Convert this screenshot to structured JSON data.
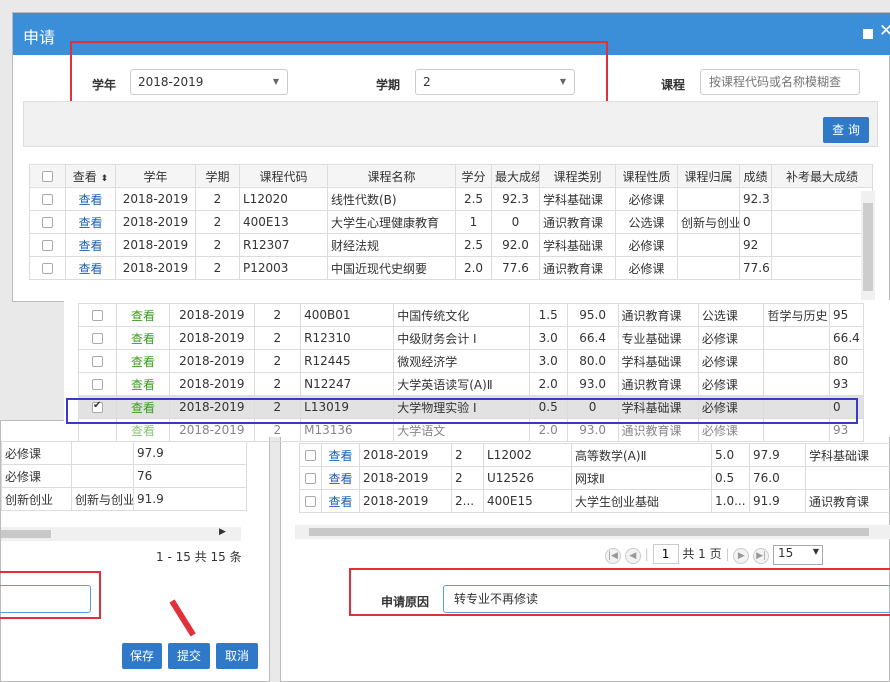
{
  "dialog": {
    "title": "申请",
    "filters": {
      "year_label": "学年",
      "year_value": "2018-2019",
      "term_label": "学期",
      "term_value": "2",
      "course_label": "课程",
      "course_placeholder": "按课程代码或名称模糊查"
    },
    "search_button": "查 询"
  },
  "grid_top": {
    "headers": [
      "查看",
      "学年",
      "学期",
      "课程代码",
      "课程名称",
      "学分",
      "最大成绩",
      "课程类别",
      "课程性质",
      "课程归属",
      "成绩",
      "补考最大成绩"
    ],
    "rows": [
      [
        "查看",
        "2018-2019",
        "2",
        "L12020",
        "线性代数(B)",
        "2.5",
        "92.3",
        "学科基础课",
        "必修课",
        "",
        "92.3"
      ],
      [
        "查看",
        "2018-2019",
        "2",
        "400E13",
        "大学生心理健康教育",
        "1",
        "0",
        "通识教育课",
        "公选课",
        "创新与创业",
        "0"
      ],
      [
        "查看",
        "2018-2019",
        "2",
        "R12307",
        "财经法规",
        "2.5",
        "92.0",
        "学科基础课",
        "必修课",
        "",
        "92"
      ],
      [
        "查看",
        "2018-2019",
        "2",
        "P12003",
        "中国近现代史纲要",
        "2.0",
        "77.6",
        "通识教育课",
        "必修课",
        "",
        "77.6"
      ]
    ]
  },
  "grid_overlay": {
    "rows": [
      [
        "查看",
        "2018-2019",
        "2",
        "400B01",
        "中国传统文化",
        "1.5",
        "95.0",
        "通识教育课",
        "公选课",
        "哲学与历史",
        "95"
      ],
      [
        "查看",
        "2018-2019",
        "2",
        "R12310",
        "中级财务会计 I",
        "3.0",
        "66.4",
        "专业基础课",
        "必修课",
        "",
        "66.4"
      ],
      [
        "查看",
        "2018-2019",
        "2",
        "R12445",
        "微观经济学",
        "3.0",
        "80.0",
        "学科基础课",
        "必修课",
        "",
        "80"
      ],
      [
        "查看",
        "2018-2019",
        "2",
        "N12247",
        "大学英语读写(A)Ⅱ",
        "2.0",
        "93.0",
        "通识教育课",
        "必修课",
        "",
        "93"
      ],
      [
        "查看",
        "2018-2019",
        "2",
        "L13019",
        "大学物理实验 I",
        "0.5",
        "0",
        "学科基础课",
        "必修课",
        "",
        "0"
      ]
    ],
    "partial_row": [
      "查看",
      "2018-2019",
      "2",
      "M13136",
      "大学语文",
      "2.0",
      "93.0",
      "通识教育课",
      "必修课",
      "",
      "93"
    ]
  },
  "left_panel": {
    "rows": [
      [
        "必修课",
        "",
        "97.9"
      ],
      [
        "必修课",
        "",
        "76"
      ],
      [
        "创新创业",
        "创新与创业",
        "91.9"
      ]
    ],
    "pager_text": "1 - 15   共 15 条",
    "save_button": "保存",
    "submit_button": "提交",
    "cancel_button": "取消"
  },
  "grid_bottom": {
    "rows": [
      [
        "查看",
        "2018-2019",
        "2",
        "L12002",
        "高等数学(A)Ⅱ",
        "5.0",
        "97.9",
        "学科基础课"
      ],
      [
        "查看",
        "2018-2019",
        "2",
        "U12526",
        "网球Ⅱ",
        "0.5",
        "76.0",
        ""
      ],
      [
        "查看",
        "2018-2019",
        "2...",
        "400E15",
        "大学生创业基础",
        "1.0...",
        "91.9",
        "通识教育课"
      ]
    ],
    "pager": {
      "page_value": "1",
      "total_pages": "共 1 页",
      "page_size": "15"
    },
    "reason_label": "申请原因",
    "reason_value": "转专业不再修读"
  },
  "colors": {
    "header_blue": "#3b8fd9",
    "button_blue": "#2f79c8",
    "highlight_red": "#e0303a",
    "highlight_blue": "#3a3ac8",
    "link_blue": "#1a5fb4",
    "link_green": "#3b9b1f"
  }
}
